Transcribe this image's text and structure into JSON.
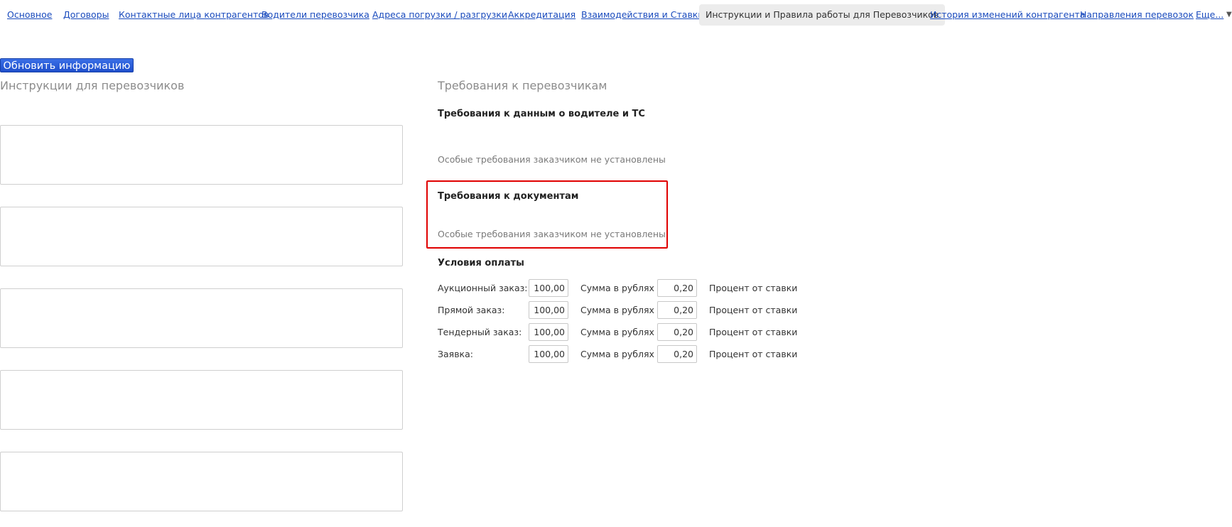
{
  "nav": {
    "items": [
      {
        "label": "Основное"
      },
      {
        "label": "Договоры"
      },
      {
        "label": "Контактные лица контрагентов"
      },
      {
        "label": "Водители перевозчика"
      },
      {
        "label": "Адреса погрузки / разгрузки"
      },
      {
        "label": "Аккредитация"
      },
      {
        "label": "Взаимодействия и Ставки"
      },
      {
        "label": "Инструкции и Правила работы для Перевозчиков",
        "active": true
      },
      {
        "label": "История изменений контрагента"
      },
      {
        "label": "Направления перевозок"
      },
      {
        "label": "Еще..."
      }
    ],
    "more_arrow_icon": "chevron-down-icon"
  },
  "toolbar": {
    "refresh_label": "Обновить информацию"
  },
  "instructions": {
    "title": "Инструкции для перевозчиков",
    "fields": [
      "",
      "",
      "",
      "",
      ""
    ]
  },
  "requirements": {
    "title": "Требования к перевозчикам",
    "driver_vehicle": {
      "heading": "Требования к данным о водителе и ТС",
      "note": "Особые требования заказчиком не установлены"
    },
    "documents": {
      "heading": "Требования к документам",
      "note": "Особые требования заказчиком не установлены",
      "highlight_color": "#e00000"
    }
  },
  "payment": {
    "heading": "Условия оплаты",
    "sum_unit": "Сумма в рублях",
    "percent_unit": "Процент от ставки",
    "rows": [
      {
        "label": "Аукционный заказ:",
        "sum": "100,00",
        "percent": "0,20"
      },
      {
        "label": "Прямой заказ:",
        "sum": "100,00",
        "percent": "0,20"
      },
      {
        "label": "Тендерный заказ:",
        "sum": "100,00",
        "percent": "0,20"
      },
      {
        "label": "Заявка:",
        "sum": "100,00",
        "percent": "0,20"
      }
    ]
  },
  "colors": {
    "link": "#1a4bbd",
    "button": "#1f4fcc",
    "active_tab_bg": "#ececec"
  }
}
